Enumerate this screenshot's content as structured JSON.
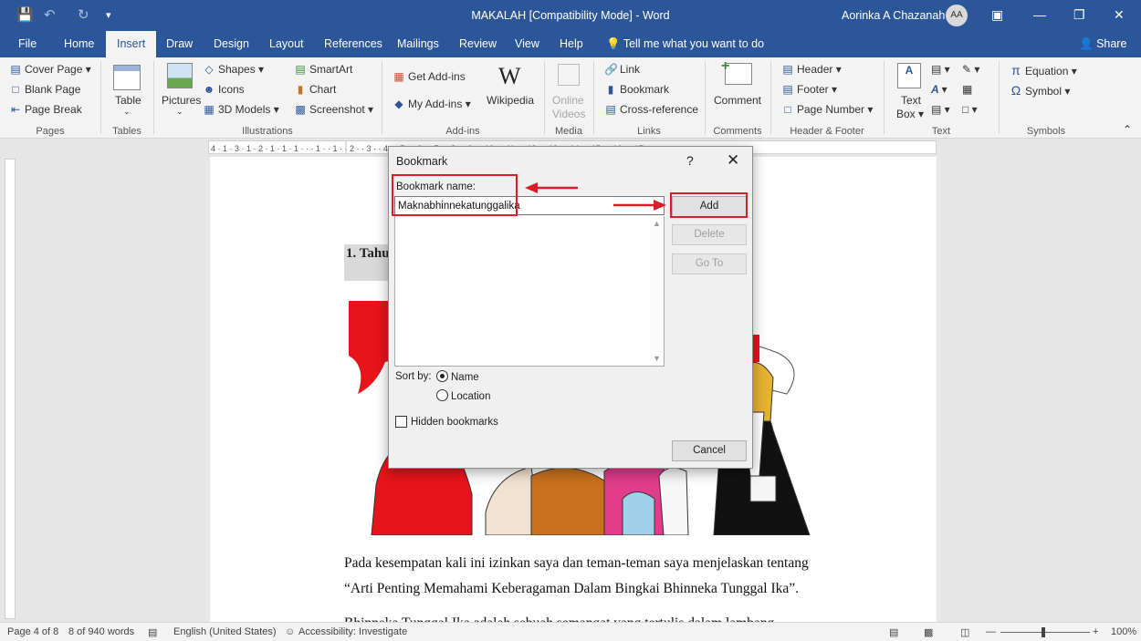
{
  "window": {
    "title": "MAKALAH [Compatibility Mode] - Word",
    "user": "Aorinka A Chazanah",
    "avatar_initials": "AA"
  },
  "tabs": [
    "File",
    "Home",
    "Insert",
    "Draw",
    "Design",
    "Layout",
    "References",
    "Mailings",
    "Review",
    "View",
    "Help"
  ],
  "active_tab": "Insert",
  "tell_me": "Tell me what you want to do",
  "share": "Share",
  "ribbon": {
    "pages": {
      "label": "Pages",
      "cover": "Cover Page",
      "blank": "Blank Page",
      "break": "Page Break"
    },
    "tables": {
      "label": "Tables",
      "table": "Table"
    },
    "illustrations": {
      "label": "Illustrations",
      "pictures": "Pictures",
      "shapes": "Shapes",
      "icons": "Icons",
      "models": "3D Models",
      "smartart": "SmartArt",
      "chart": "Chart",
      "screenshot": "Screenshot"
    },
    "addins": {
      "label": "Add-ins",
      "get": "Get Add-ins",
      "my": "My Add-ins",
      "wikipedia": "Wikipedia"
    },
    "media": {
      "label": "Media",
      "online_videos_1": "Online",
      "online_videos_2": "Videos"
    },
    "links": {
      "label": "Links",
      "link": "Link",
      "bookmark": "Bookmark",
      "crossref": "Cross-reference"
    },
    "comments": {
      "label": "Comments",
      "comment": "Comment"
    },
    "headerfooter": {
      "label": "Header & Footer",
      "header": "Header",
      "footer": "Footer",
      "pagenum": "Page Number"
    },
    "text": {
      "label": "Text",
      "textbox_1": "Text",
      "textbox_2": "Box"
    },
    "symbols": {
      "label": "Symbols",
      "equation": "Equation",
      "symbol": "Symbol"
    }
  },
  "document": {
    "heading": "1. Tahu",
    "para1_line1": "Pada kesempatan kali ini izinkan  saya dan teman-teman saya menjelaskan tentang",
    "para1_line2": "“Arti Penting Memahami Keberagaman Dalam Bingkai Bhinneka Tunggal Ika”.",
    "para2_partial": "Bhinneka Tunggal Ika adalah sebuah semangat yang tertulis dalam lambang"
  },
  "dialog": {
    "title": "Bookmark",
    "help": "?",
    "close": "✕",
    "name_label": "Bookmark name:",
    "name_value": "Maknabhinnekatunggalika",
    "add": "Add",
    "delete": "Delete",
    "goto": "Go To",
    "sort_by": "Sort by:",
    "sort_name": "Name",
    "sort_location": "Location",
    "hidden": "Hidden bookmarks",
    "cancel": "Cancel"
  },
  "status": {
    "page": "Page 4 of 8",
    "words": "8 of 940 words",
    "language": "English (United States)",
    "accessibility": "Accessibility: Investigate",
    "zoom": "100%"
  },
  "colors": {
    "word_blue": "#2b579a",
    "annotation_red": "#d81e28"
  }
}
